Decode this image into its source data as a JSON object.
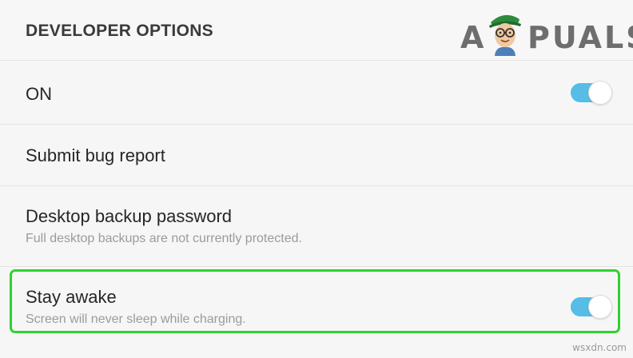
{
  "header": {
    "title": "DEVELOPER OPTIONS",
    "logo_prefix": "A",
    "logo_suffix": "PUALS"
  },
  "master_toggle": {
    "label": "ON",
    "checked": true
  },
  "items": [
    {
      "label": "Submit bug report"
    },
    {
      "label": "Desktop backup password",
      "summary": "Full desktop backups are not currently protected."
    },
    {
      "label": "Stay awake",
      "summary": "Screen will never sleep while charging.",
      "checked": true,
      "highlighted": true
    }
  ],
  "colors": {
    "toggle_on": "#55bde6",
    "highlight": "#2fd22f",
    "background": "#f6f6f6"
  },
  "watermark": "wsxdn.com"
}
